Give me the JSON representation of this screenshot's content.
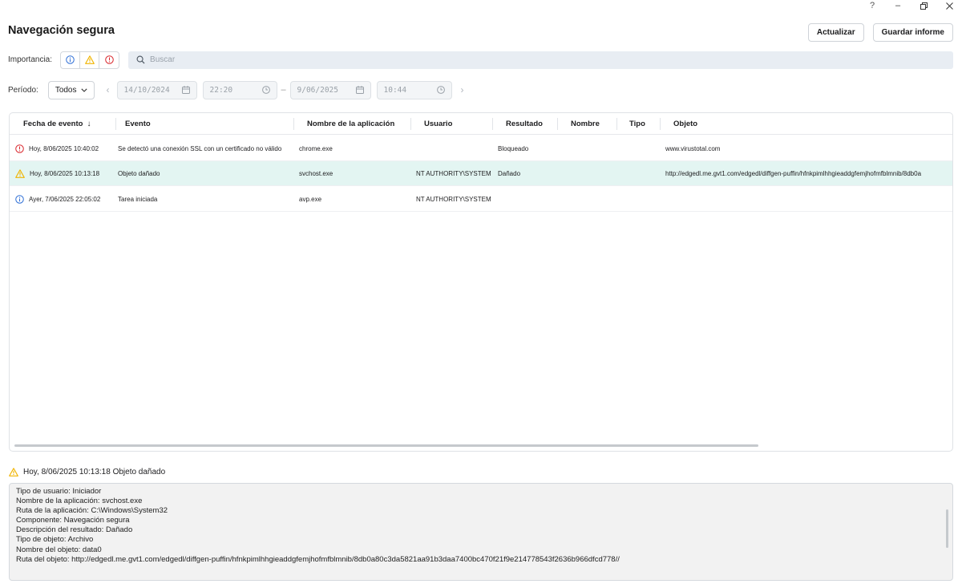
{
  "window": {
    "help_glyph": "?",
    "minimize_glyph": "–"
  },
  "page": {
    "title": "Navegación segura"
  },
  "toolbar": {
    "refresh_label": "Actualizar",
    "save_report_label": "Guardar informe"
  },
  "filters": {
    "importance_label": "Importancia:",
    "search_placeholder": "Buscar",
    "period_label": "Período:",
    "period_select": "Todos",
    "date_from": "14/10/2024",
    "time_from": "22:20",
    "date_to": "9/06/2025",
    "time_to": "10:44",
    "range_dash": "–",
    "prev_arrow": "‹",
    "next_arrow": "›"
  },
  "colors": {
    "info": "#2f6fd6",
    "warning": "#f0b400",
    "critical": "#d9262c",
    "selected_row": "#e3f5f2"
  },
  "table": {
    "columns": [
      "Fecha de evento",
      "Evento",
      "Nombre de la aplicación",
      "Usuario",
      "Resultado",
      "Nombre",
      "Tipo",
      "Objeto"
    ],
    "sort_glyph": "↓",
    "rows": [
      {
        "severity": "critical",
        "icon": "critical-icon",
        "date": "Hoy, 8/06/2025 10:40:02",
        "event": "Se detectó una conexión SSL con un certificado no válido",
        "app": "chrome.exe",
        "user": "",
        "result": "Bloqueado",
        "name": "",
        "type": "",
        "object": "www.virustotal.com"
      },
      {
        "severity": "warning",
        "icon": "warning-icon",
        "date": "Hoy, 8/06/2025 10:13:18",
        "event": "Objeto dañado",
        "app": "svchost.exe",
        "user": "NT AUTHORITY\\SYSTEM",
        "result": "Dañado",
        "name": "",
        "type": "",
        "object": "http://edgedl.me.gvt1.com/edgedl/diffgen-puffin/hfnkpimlhhgieaddgfemjhofmfblmnib/8db0a"
      },
      {
        "severity": "info",
        "icon": "info-icon",
        "date": "Ayer, 7/06/2025 22:05:02",
        "event": "Tarea iniciada",
        "app": "avp.exe",
        "user": "NT AUTHORITY\\SYSTEM",
        "result": "",
        "name": "",
        "type": "",
        "object": ""
      }
    ]
  },
  "details": {
    "header": "Hoy, 8/06/2025 10:13:18 Objeto dañado",
    "lines": [
      "Tipo de usuario: Iniciador",
      "Nombre de la aplicación: svchost.exe",
      "Ruta de la aplicación: C:\\Windows\\System32",
      "Componente: Navegación segura",
      "Descripción del resultado: Dañado",
      "Tipo de objeto: Archivo",
      "Nombre del objeto: data0",
      "Ruta del objeto: http://edgedl.me.gvt1.com/edgedl/diffgen-puffin/hfnkpimlhhgieaddgfemjhofmfblmnib/8db0a80c3da5821aa91b3daa7400bc470f21f9e214778543f2636b966dfcd778//"
    ]
  }
}
